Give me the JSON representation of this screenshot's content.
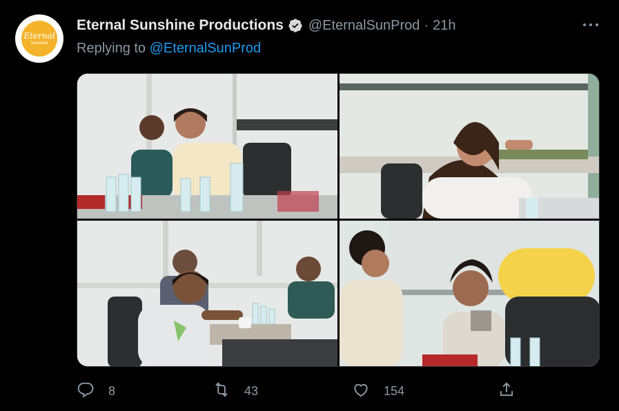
{
  "account": {
    "avatar_line1": "Eternal",
    "avatar_line2": "Sunshine",
    "display_name": "Eternal Sunshine Productions",
    "verified_icon": "verified-badge-icon",
    "handle": "@EternalSunProd",
    "separator": "·",
    "time": "21h"
  },
  "reply_context": {
    "prefix": "Replying to",
    "mention": "@EternalSunProd"
  },
  "media": {
    "photos": [
      {
        "name": "photo-1"
      },
      {
        "name": "photo-2"
      },
      {
        "name": "photo-3"
      },
      {
        "name": "photo-4"
      }
    ]
  },
  "actions": {
    "reply_count": "8",
    "retweet_count": "43",
    "like_count": "154"
  },
  "colors": {
    "background": "#000000",
    "text_primary": "#e7e9ea",
    "text_secondary": "#8b98a5",
    "link": "#1d9bf0"
  }
}
